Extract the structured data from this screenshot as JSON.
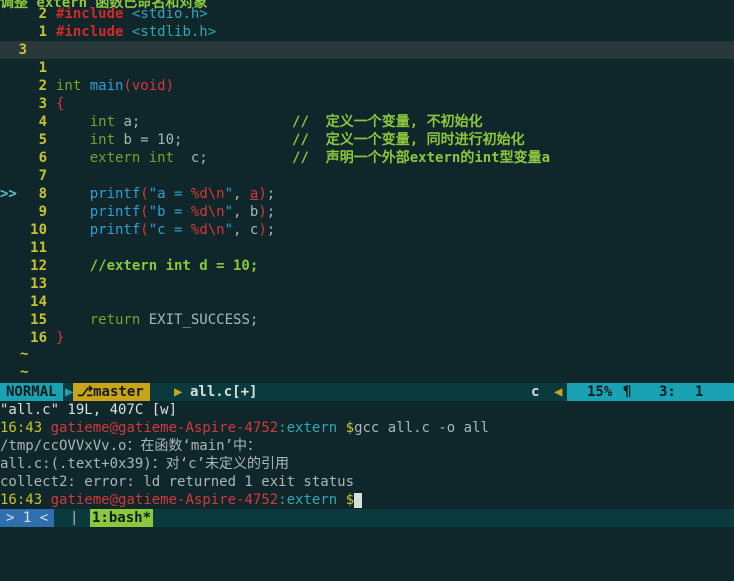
{
  "title_fragment": "调整 extern 函数已命名和对象",
  "editor": {
    "lines": [
      {
        "rel": "2",
        "kind": "include",
        "kw": "#include",
        "arg": "<stdio.h>"
      },
      {
        "rel": "1",
        "kind": "include",
        "kw": "#include",
        "arg": "<stdlib.h>"
      },
      {
        "rel": "3",
        "kind": "cursor"
      },
      {
        "rel": "1",
        "kind": "blank"
      },
      {
        "rel": "2",
        "kind": "main",
        "type": "int",
        "name": "main",
        "args": "(void)"
      },
      {
        "rel": "3",
        "kind": "brace",
        "text": "{"
      },
      {
        "rel": "4",
        "kind": "decl",
        "code": "int a;",
        "comment": "//  定义一个变量, 不初始化"
      },
      {
        "rel": "5",
        "kind": "decl",
        "code": "int b = 10;",
        "comment": "//  定义一个变量, 同时进行初始化"
      },
      {
        "rel": "6",
        "kind": "decl",
        "code": "extern int  c;",
        "comment": "//  声明一个外部extern的int型变量a"
      },
      {
        "rel": "7",
        "kind": "blank"
      },
      {
        "rel": "8",
        "kind": "printf",
        "sign": ">>",
        "fn": "printf",
        "str": "\"a = %d\\n\"",
        "var": "a"
      },
      {
        "rel": "9",
        "kind": "printf",
        "fn": "printf",
        "str": "\"b = %d\\n\"",
        "var": "b"
      },
      {
        "rel": "10",
        "kind": "printf",
        "fn": "printf",
        "str": "\"c = %d\\n\"",
        "var": "c"
      },
      {
        "rel": "11",
        "kind": "blank"
      },
      {
        "rel": "12",
        "kind": "comment",
        "text": "//extern int d = 10;"
      },
      {
        "rel": "13",
        "kind": "blank"
      },
      {
        "rel": "14",
        "kind": "blank"
      },
      {
        "rel": "15",
        "kind": "return",
        "kw": "return",
        "val": "EXIT_SUCCESS;"
      },
      {
        "rel": "16",
        "kind": "brace",
        "text": "}"
      }
    ],
    "tilde": "~"
  },
  "statusline": {
    "mode": "NORMAL",
    "branch": "⎇master",
    "filename": "all.c[+]",
    "filetype": "c",
    "percent": "15%",
    "para": "¶",
    "line": "3:",
    "col": "1"
  },
  "terminal": {
    "lines": [
      {
        "type": "msg",
        "text": "\"all.c\" 19L, 407C [w]"
      },
      {
        "type": "prompt",
        "time": "16:43",
        "user": "gatieme",
        "host": "@gatieme-Aspire-4752",
        "dir": ":extern",
        "dollar": "$",
        "cmd": "gcc all.c -o all"
      },
      {
        "type": "plain",
        "text": "/tmp/ccOVVxVv.o：在函数‘main’中："
      },
      {
        "type": "plain",
        "text": "all.c:(.text+0x39)：对‘c’未定义的引用"
      },
      {
        "type": "plain",
        "text": "collect2: error: ld returned 1 exit status"
      },
      {
        "type": "prompt",
        "time": "16:43",
        "user": "gatieme",
        "host": "@gatieme-Aspire-4752",
        "dir": ":extern",
        "dollar": "$",
        "cmd": ""
      }
    ]
  },
  "tmux": {
    "session": "> 1 <",
    "sep": "|",
    "window_index": "1:",
    "window_name": "bash*"
  }
}
